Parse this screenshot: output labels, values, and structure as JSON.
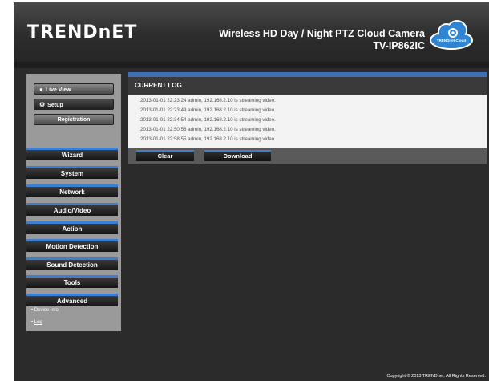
{
  "header": {
    "logo": "TRENDnET",
    "product_line1": "Wireless HD Day / Night PTZ Cloud Camera",
    "product_line2": "TV-IP862IC",
    "cloud_label": "TRENDnet Cloud"
  },
  "panel": {
    "live_view": "Live View",
    "setup": "Setup",
    "registration": "Registration"
  },
  "nav": [
    {
      "label": "Wizard"
    },
    {
      "label": "System"
    },
    {
      "label": "Network"
    },
    {
      "label": "Audio/Video"
    },
    {
      "label": "Action"
    },
    {
      "label": "Motion Detection"
    },
    {
      "label": "Sound Detection"
    },
    {
      "label": "Tools"
    },
    {
      "label": "Advanced"
    }
  ],
  "submenu": {
    "device_info": "Device Info",
    "log": "Log"
  },
  "content": {
    "title": "CURRENT LOG",
    "log_lines": [
      "2013-01-01 22:23:24  admin, 192.168.2.10 is streaming video.",
      "2013-01-01 22:23:49  admin, 192.168.2.10 is streaming video.",
      "2013-01-01 22:34:54  admin, 192.168.2.10 is streaming video.",
      "2013-01-01 22:50:56  admin, 192.168.2.10 is streaming video.",
      "2013-01-01 22:58:55  admin, 192.168.2.10 is streaming video."
    ],
    "clear_label": "Clear",
    "download_label": "Download"
  },
  "footer": {
    "copyright": "Copyright © 2013 TRENDnet. All Rights Reserved."
  },
  "colors": {
    "accent": "#3c7fd0",
    "background": "#2b2b2b",
    "content_bg": "#e9e9e9"
  }
}
